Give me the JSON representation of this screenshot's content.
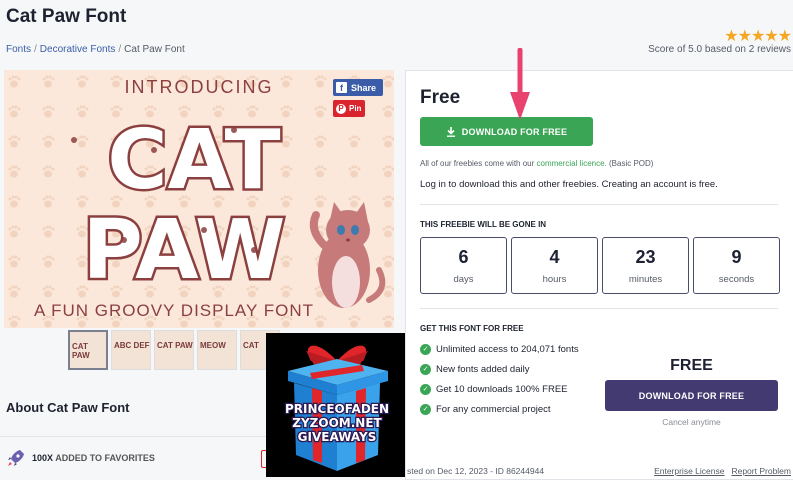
{
  "page": {
    "title": "Cat Paw Font"
  },
  "breadcrumb": {
    "items": [
      "Fonts",
      "Decorative Fonts",
      "Cat Paw Font"
    ]
  },
  "rating": {
    "stars_filled": 5,
    "stars_total": 5,
    "text": "Score of 5.0 based on 2 reviews"
  },
  "preview": {
    "intro": "INTRODUCING",
    "headline1": "CAT",
    "headline2": "PAW",
    "tagline": "A FUN GROOVY DISPLAY FONT",
    "share_label": "Share",
    "pin_label": "Pin",
    "thumbnails": [
      "CAT PAW",
      "ABC DEF",
      "CAT PAW",
      "MEOW",
      "CAT"
    ]
  },
  "about": {
    "title": "About Cat Paw Font"
  },
  "favorites": {
    "count": "100X",
    "label": "ADDED TO FAVORITES"
  },
  "giveaway": {
    "line1": "PRINCEOFADEN",
    "line2": "ZYZOOM.NET",
    "line3": "GIVEAWAYS"
  },
  "panel": {
    "price_title": "Free",
    "download_label": "DOWNLOAD FOR FREE",
    "license_prefix": "All of our freebies come with our",
    "license_link": "commercial licence.",
    "license_suffix": "(Basic POD)",
    "login_note": "Log in to download this and other freebies. Creating an account is free.",
    "countdown_label": "THIS FREEBIE WILL BE GONE IN",
    "countdown": [
      {
        "value": "6",
        "unit": "days"
      },
      {
        "value": "4",
        "unit": "hours"
      },
      {
        "value": "23",
        "unit": "minutes"
      },
      {
        "value": "9",
        "unit": "seconds"
      }
    ],
    "get_label": "GET THIS FONT FOR FREE",
    "features": [
      "Unlimited access to 204,071 fonts",
      "New fonts added daily",
      "Get 10 downloads 100% FREE",
      "For any commercial project"
    ],
    "free_big": "FREE",
    "download_label2": "DOWNLOAD FOR FREE",
    "cancel_note": "Cancel anytime"
  },
  "footer": {
    "meta": "sted on Dec 12, 2023 - ID 86244944",
    "links": [
      "Enterprise License",
      "Report Problem"
    ]
  },
  "colors": {
    "green": "#3aa655",
    "purple": "#443a72",
    "arrow": "#e8436e",
    "font_color": "#7a3b3b"
  }
}
